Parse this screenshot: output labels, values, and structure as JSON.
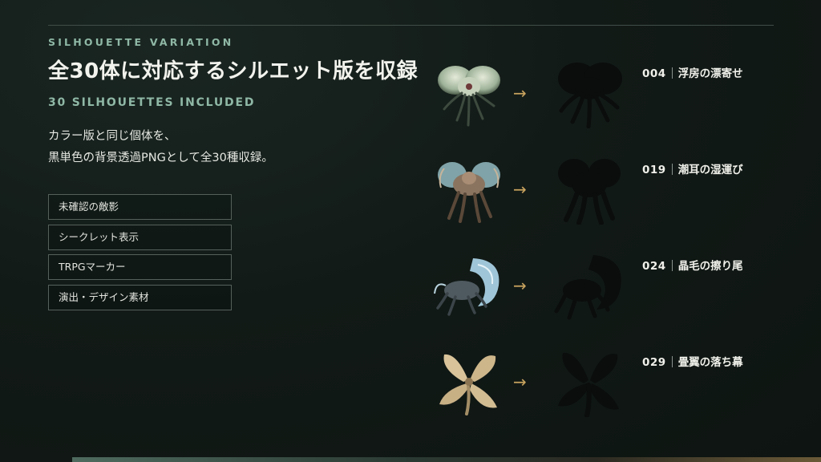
{
  "header": {
    "eyebrow": "SILHOUETTE VARIATION",
    "title": "全30体に対応するシルエット版を収録",
    "subtitle": "30 SILHOUETTES INCLUDED"
  },
  "description": {
    "line1": "カラー版と同じ個体を、",
    "line2": "黒単色の背景透過PNGとして全30種収録。"
  },
  "tags": [
    "未確認の敵影",
    "シークレット表示",
    "TRPGマーカー",
    "演出・デザイン素材"
  ],
  "arrow_glyph": "→",
  "creatures": [
    {
      "number": "004",
      "name": "浮房の漂寄せ",
      "palette": "pale-green"
    },
    {
      "number": "019",
      "name": "潮耳の湿運び",
      "palette": "teal-brown"
    },
    {
      "number": "024",
      "name": "晶毛の擦り尾",
      "palette": "ice-blue"
    },
    {
      "number": "029",
      "name": "畳翼の落ち幕",
      "palette": "tan"
    }
  ],
  "colors": {
    "accent_green": "#8fb8a6",
    "arrow_gold": "#c9a45f",
    "background": "#121a17"
  }
}
